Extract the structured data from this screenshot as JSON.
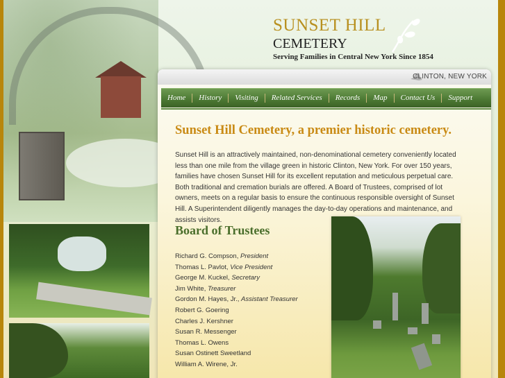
{
  "logo": {
    "title": "SUNSET HILL",
    "subtitle": "CEMETERY",
    "tagline": "Serving Families in Central New York Since 1854"
  },
  "location": "CLINTON, NEW YORK",
  "nav": [
    {
      "label": "Home"
    },
    {
      "label": "History"
    },
    {
      "label": "Visiting"
    },
    {
      "label": "Related Services"
    },
    {
      "label": "Records"
    },
    {
      "label": "Map"
    },
    {
      "label": "Contact Us"
    },
    {
      "label": "Support"
    }
  ],
  "headline": "Sunset Hill Cemetery, a premier historic cemetery.",
  "intro": "Sunset Hill is an attractively maintained, non-denominational cemetery conveniently located less than one mile from the village green in historic Clinton, New York.  For over 150 years, families have chosen Sunset Hill for its excellent reputation and meticulous perpetual care.  Both traditional and cremation burials are offered.  A Board of Trustees, comprised of lot owners, meets on a regular basis to ensure the continuous responsible oversight of Sunset Hill. A Superintendent diligently manages the day-to-day operations and maintenance, and assists visitors.",
  "board": {
    "title": "Board of Trustees",
    "members": [
      {
        "name": "Richard G. Compson,",
        "role": "President"
      },
      {
        "name": "Thomas L. Pavlot,",
        "role": "Vice President"
      },
      {
        "name": "George M. Kuckel,",
        "role": "Secretary"
      },
      {
        "name": "Jim White,",
        "role": "Treasurer"
      },
      {
        "name": "Gordon M. Hayes, Jr.,",
        "role": "Assistant Treasurer"
      },
      {
        "name": "Robert G. Goering",
        "role": ""
      },
      {
        "name": "Charles J. Kershner",
        "role": ""
      },
      {
        "name": "Susan R. Messenger",
        "role": ""
      },
      {
        "name": "Thomas L. Owens",
        "role": ""
      },
      {
        "name": "Susan Ostinett Sweetland",
        "role": ""
      },
      {
        "name": "William A. Wirene, Jr.",
        "role": ""
      }
    ]
  },
  "colors": {
    "frame": "#b8860b",
    "nav_green": "#4d7a34",
    "headline_gold": "#c98a14",
    "board_green": "#4a6e2b",
    "logo_gold": "#b89020"
  }
}
